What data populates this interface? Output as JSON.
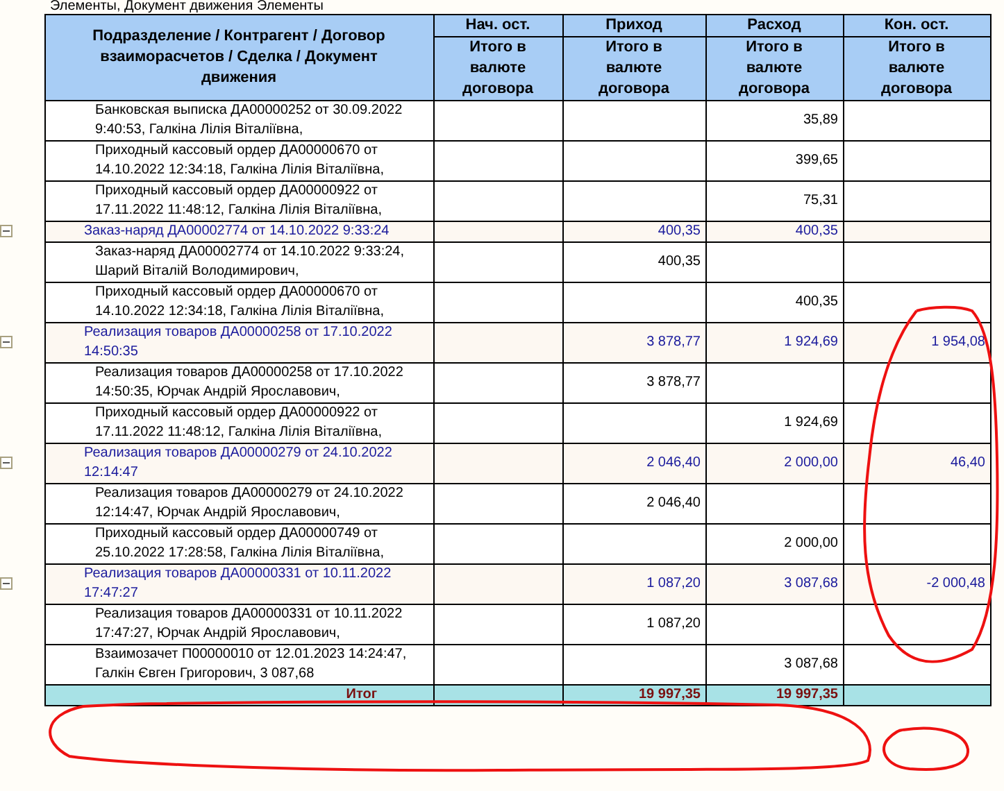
{
  "report_title": "Элементы, Документ движения Элементы",
  "columns": [
    {
      "title": "Подразделение / Контрагент / Договор взаиморасчетов / Сделка / Документ движения"
    },
    {
      "title": "Нач. ост.",
      "subtitle": "Итого в валюте договора"
    },
    {
      "title": "Приход",
      "subtitle": "Итого в валюте договора"
    },
    {
      "title": "Расход",
      "subtitle": "Итого в валюте договора"
    },
    {
      "title": "Кон. ост.",
      "subtitle": "Итого в валюте договора"
    }
  ],
  "rows": [
    {
      "kind": "detail",
      "text": "Банковская выписка ДА00000252 от 30.09.2022 9:40:53, Галкіна Лілія Віталіївна,",
      "values": {
        "expense": "35,89"
      }
    },
    {
      "kind": "detail",
      "text": "Приходный кассовый ордер ДА00000670 от 14.10.2022 12:34:18, Галкіна Лілія Віталіївна,",
      "values": {
        "expense": "399,65"
      }
    },
    {
      "kind": "detail",
      "text": "Приходный кассовый ордер ДА00000922 от 17.11.2022 11:48:12, Галкіна Лілія Віталіївна,",
      "values": {
        "expense": "75,31"
      }
    },
    {
      "kind": "group",
      "expanded": true,
      "text": "Заказ-наряд ДА00002774 от 14.10.2022 9:33:24",
      "values": {
        "income": "400,35",
        "expense": "400,35"
      }
    },
    {
      "kind": "detail",
      "text": "Заказ-наряд ДА00002774 от 14.10.2022 9:33:24, Шарий Віталій Володимирович,",
      "values": {
        "income": "400,35"
      }
    },
    {
      "kind": "detail",
      "text": "Приходный кассовый ордер ДА00000670 от 14.10.2022 12:34:18, Галкіна Лілія Віталіївна,",
      "values": {
        "expense": "400,35"
      }
    },
    {
      "kind": "group",
      "expanded": true,
      "text": "Реализация товаров ДА00000258 от 17.10.2022 14:50:35",
      "values": {
        "income": "3 878,77",
        "expense": "1 924,69",
        "end": "1 954,08"
      }
    },
    {
      "kind": "detail",
      "text": "Реализация товаров ДА00000258 от 17.10.2022 14:50:35, Юрчак Андрій Ярославович,",
      "values": {
        "income": "3 878,77"
      }
    },
    {
      "kind": "detail",
      "text": "Приходный кассовый ордер ДА00000922 от 17.11.2022 11:48:12, Галкіна Лілія Віталіївна,",
      "values": {
        "expense": "1 924,69"
      }
    },
    {
      "kind": "group",
      "expanded": true,
      "text": "Реализация товаров ДА00000279 от 24.10.2022 12:14:47",
      "values": {
        "income": "2 046,40",
        "expense": "2 000,00",
        "end": "46,40"
      }
    },
    {
      "kind": "detail",
      "text": "Реализация товаров ДА00000279 от 24.10.2022 12:14:47, Юрчак Андрій Ярославович,",
      "values": {
        "income": "2 046,40"
      }
    },
    {
      "kind": "detail",
      "text": "Приходный кассовый ордер ДА00000749 от 25.10.2022 17:28:58, Галкіна Лілія Віталіївна,",
      "values": {
        "expense": "2 000,00"
      }
    },
    {
      "kind": "group",
      "expanded": true,
      "text": "Реализация товаров ДА00000331 от 10.11.2022 17:47:27",
      "values": {
        "income": "1 087,20",
        "expense": "3 087,68",
        "end": "-2 000,48"
      }
    },
    {
      "kind": "detail",
      "text": "Реализация товаров ДА00000331 от 10.11.2022 17:47:27, Юрчак Андрій Ярославович,",
      "values": {
        "income": "1 087,20"
      }
    },
    {
      "kind": "detail",
      "text": "Взаимозачет П00000010 от 12.01.2023 14:24:47, Галкін Євген Григорович, 3 087,68",
      "values": {
        "expense": "3 087,68"
      }
    }
  ],
  "total": {
    "label": "Итог",
    "income": "19 997,35",
    "expense": "19 997,35"
  }
}
